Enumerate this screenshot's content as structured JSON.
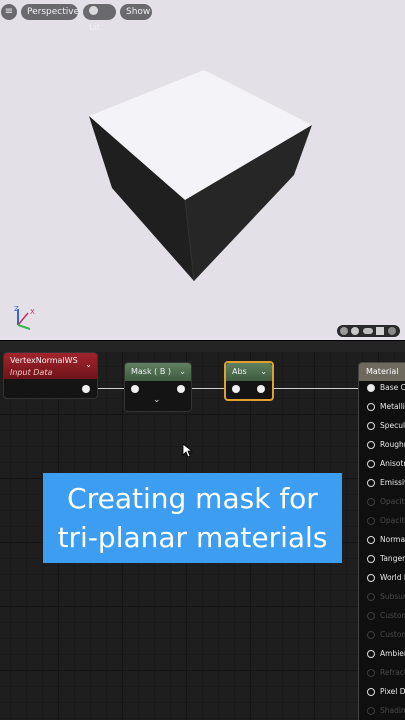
{
  "viewport": {
    "toolbar": {
      "menu_icon": "≡",
      "perspective_label": "Perspective",
      "lit_label": "Lit",
      "show_label": "Show"
    },
    "axis_labels": {
      "z": "Z",
      "x": "X"
    }
  },
  "graph": {
    "nodes": {
      "vertex_normal": {
        "title": "VertexNormalWS",
        "subtitle": "Input Data"
      },
      "mask": {
        "title": "Mask ( B )"
      },
      "abs": {
        "title": "Abs"
      }
    },
    "material": {
      "title": "Material",
      "inputs": [
        {
          "label": "Base Co",
          "state": "on",
          "filled": true
        },
        {
          "label": "Metallic",
          "state": "on",
          "filled": false
        },
        {
          "label": "Specula",
          "state": "on",
          "filled": false
        },
        {
          "label": "Roughn",
          "state": "on",
          "filled": false
        },
        {
          "label": "Anisotr",
          "state": "on",
          "filled": false
        },
        {
          "label": "Emissiv",
          "state": "on",
          "filled": false
        },
        {
          "label": "Opacity",
          "state": "off",
          "filled": false
        },
        {
          "label": "Opacity",
          "state": "off",
          "filled": false
        },
        {
          "label": "Normal",
          "state": "on",
          "filled": false
        },
        {
          "label": "Tangen",
          "state": "on",
          "filled": false
        },
        {
          "label": "World P",
          "state": "on",
          "filled": false
        },
        {
          "label": "Subsurf",
          "state": "off",
          "filled": false
        },
        {
          "label": "Custom",
          "state": "off",
          "filled": false
        },
        {
          "label": "Custom",
          "state": "off",
          "filled": false
        },
        {
          "label": "Ambien",
          "state": "on",
          "filled": false
        },
        {
          "label": "Refract",
          "state": "off",
          "filled": false
        },
        {
          "label": "Pixel De",
          "state": "on",
          "filled": false
        },
        {
          "label": "Shadin",
          "state": "off",
          "filled": false
        }
      ]
    }
  },
  "caption": {
    "line1": "Creating mask for",
    "line2": "tri-planar materials"
  },
  "colors": {
    "vertex_header": "#8a1c22",
    "mask_header": "#4f6f4f",
    "abs_header": "#4f6f4f",
    "abs_border": "#e0a030",
    "caption_bg": "#3d9df0"
  }
}
